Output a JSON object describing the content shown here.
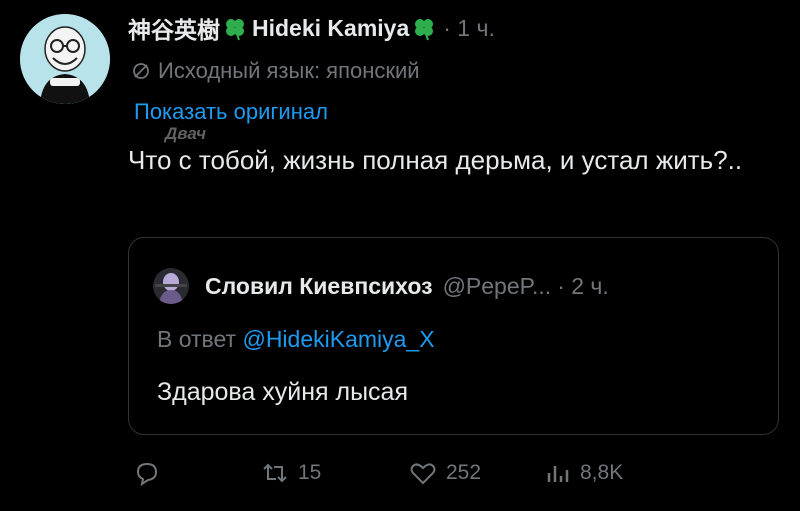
{
  "tweet": {
    "author_name": "神谷英樹",
    "author_name_en": "Hideki Kamiya",
    "time": "· 1 ч.",
    "source_language": "Исходный язык: японский",
    "show_original": "Показать оригинал",
    "watermark": "Двач",
    "text": "Что с тобой, жизнь полная дерьма, и устал жить?.."
  },
  "quote": {
    "author_name": "Словил Киевпсихоз",
    "handle": "@PepeP...",
    "time": "· 2 ч.",
    "reply_prefix": "В ответ",
    "reply_mention": "@HidekiKamiya_X",
    "text": "Здарова хуйня лысая"
  },
  "actions": {
    "reply_count": "",
    "retweet_count": "15",
    "like_count": "252",
    "views_count": "8,8K"
  },
  "colors": {
    "background": "#000000",
    "text": "#e7e9ea",
    "muted": "#71767b",
    "link": "#1d9bf0",
    "border": "#2f3336",
    "clover": "#2fae4e"
  },
  "icons": [
    "avatar",
    "clover-icon",
    "translate-icon",
    "reply-icon",
    "retweet-icon",
    "like-icon",
    "views-icon"
  ]
}
